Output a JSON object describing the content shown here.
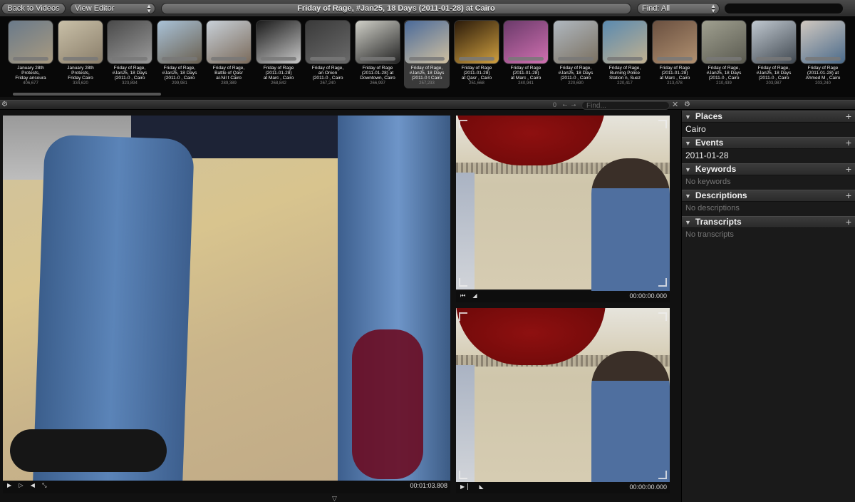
{
  "toolbar": {
    "back_label": "Back to Videos",
    "view_label": "View Editor",
    "title": "Friday of Rage, #Jan25, 18 Days (2011-01-28) at Cairo",
    "find_label": "Find: All",
    "search_value": ""
  },
  "filmstrip": {
    "thumbs": [
      {
        "caption": "January 28th\nProtests,\nFriday  ansoura",
        "count": "406,677",
        "colors": [
          "#6a7a8a",
          "#a89a80"
        ]
      },
      {
        "caption": "January 28th\nProtests,\nFriday    Cairo",
        "count": "334,620",
        "colors": [
          "#c9c0a8",
          "#8a7e6a"
        ]
      },
      {
        "caption": "Friday of Rage,\n#Jan25, 18 Days\n(2011-0  , Cairo",
        "count": "323,894",
        "colors": [
          "#4a4a4a",
          "#9a9a9a"
        ]
      },
      {
        "caption": "Friday of Rage,\n#Jan25, 18 Days\n(2011-0  , Cairo",
        "count": "299,981",
        "colors": [
          "#a9c2d8",
          "#6a6050"
        ]
      },
      {
        "caption": "Friday of Rage,\nBattle of Qasr\nal-Nil   t Cairo",
        "count": "289,389",
        "colors": [
          "#c8d0d8",
          "#7a6a5a"
        ]
      },
      {
        "caption": "Friday of Rage\n(2011-01-28)\nat Marc   , Cairo",
        "count": "268,842",
        "colors": [
          "#1a1a1a",
          "#c8c8c8"
        ]
      },
      {
        "caption": "Friday of Rage,\nan Onion\n(2011-0  , Cairo",
        "count": "267,240",
        "colors": [
          "#3a3a3a",
          "#6a6a6a"
        ]
      },
      {
        "caption": "Friday of Rage\n(2011-01-28) at\nDowntown, Cairo",
        "count": "266,997",
        "colors": [
          "#d0d0c8",
          "#222"
        ]
      },
      {
        "caption": "Friday of Rage,\n#Jan25, 18 Days\n(2011-0  t Cairo",
        "count": "257,233",
        "colors": [
          "#4a6a9a",
          "#d0c0a0"
        ]
      },
      {
        "caption": "Friday of Rage\n(2011-01-28)\nat Qasr   , Cairo",
        "count": "251,668",
        "colors": [
          "#2a1a0a",
          "#d0a040"
        ]
      },
      {
        "caption": "Friday of Rage\n(2011-01-28)\nat Marc   , Cairo",
        "count": "240,941",
        "colors": [
          "#6a3a6a",
          "#d070b0"
        ]
      },
      {
        "caption": "Friday of Rage,\n#Jan25, 18 Days\n(2011-0  , Cairo",
        "count": "220,690",
        "colors": [
          "#b0b8c0",
          "#7a7060"
        ]
      },
      {
        "caption": "Friday of Rage,\nBurning Police\nStation   n, Suez",
        "count": "220,417",
        "colors": [
          "#5a8ab0",
          "#c0b090"
        ]
      },
      {
        "caption": "Friday of Rage\n(2011-01-28)\nat Marc   , Cairo",
        "count": "213,478",
        "colors": [
          "#6a5040",
          "#b09070"
        ]
      },
      {
        "caption": "Friday of Rage,\n#Jan25, 18 Days\n(2011-0   , Cairo",
        "count": "210,439",
        "colors": [
          "#a0a090",
          "#5a5a50"
        ]
      },
      {
        "caption": "Friday of Rage,\n#Jan25, 18 Days\n(2011-0   , Cairo",
        "count": "203,987",
        "colors": [
          "#c0c8d0",
          "#404850"
        ]
      },
      {
        "caption": "Friday of Rage\n(2011-01-28) at\nAhmed M   , Cairo",
        "count": "203,240",
        "colors": [
          "#d0c8c0",
          "#4a6a8a"
        ]
      }
    ],
    "selected_index": 8
  },
  "midbar": {
    "count": "0",
    "find_placeholder": "Find..."
  },
  "players": {
    "main_time": "00:01:03.808",
    "top_time": "00:00:00.000",
    "bottom_time": "00:00:00.000"
  },
  "panel": {
    "sections": [
      {
        "title": "Places",
        "value": "Cairo",
        "muted": false
      },
      {
        "title": "Events",
        "value": "2011-01-28",
        "muted": false
      },
      {
        "title": "Keywords",
        "value": "No keywords",
        "muted": true
      },
      {
        "title": "Descriptions",
        "value": "No descriptions",
        "muted": true
      },
      {
        "title": "Transcripts",
        "value": "No transcripts",
        "muted": true
      }
    ]
  }
}
